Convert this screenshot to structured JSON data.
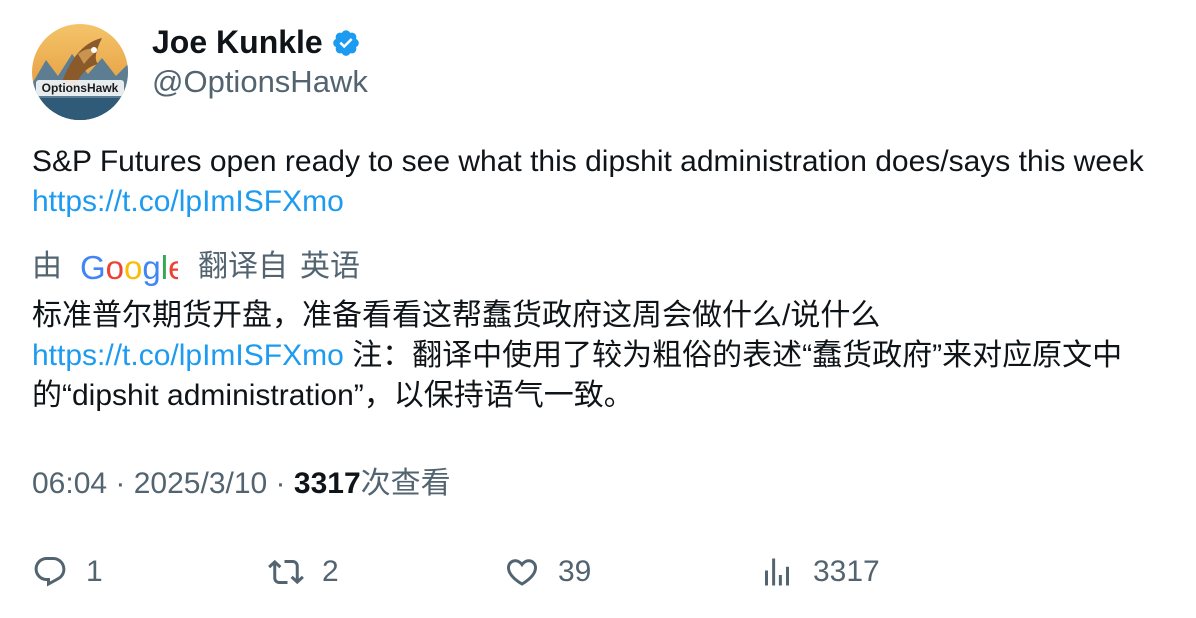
{
  "author": {
    "display_name": "Joe Kunkle",
    "handle": "@OptionsHawk",
    "verified": true,
    "avatar_text": "OptionsHawk"
  },
  "tweet": {
    "text": "S&P Futures open ready to see what this dipshit administration does/says this week",
    "link": "https://t.co/lpImISFXmo"
  },
  "translation": {
    "by": "由",
    "provider": "Google",
    "translated_from": "翻译自",
    "language": "英语",
    "text_before": "标准普尔期货开盘，准备看看这帮蠢货政府这周会做什么/说什么",
    "link": "https://t.co/lpImISFXmo",
    "text_after": " 注：翻译中使用了较为粗俗的表述“蠢货政府”来对应原文中的“dipshit administration”，以保持语气一致。"
  },
  "meta": {
    "time": "06:04",
    "separator": " · ",
    "date": "2025/3/10",
    "views_count": "3317",
    "views_label": "次查看"
  },
  "actions": {
    "replies": "1",
    "retweets": "2",
    "likes": "39",
    "views": "3317"
  },
  "icons": {
    "reply": "reply-icon",
    "retweet": "retweet-icon",
    "like": "heart-icon",
    "views": "views-icon",
    "verified": "verified-badge-icon"
  },
  "colors": {
    "text": "#0f1419",
    "secondary": "#536471",
    "link": "#1d9bf0",
    "verified": "#1d9bf0"
  }
}
